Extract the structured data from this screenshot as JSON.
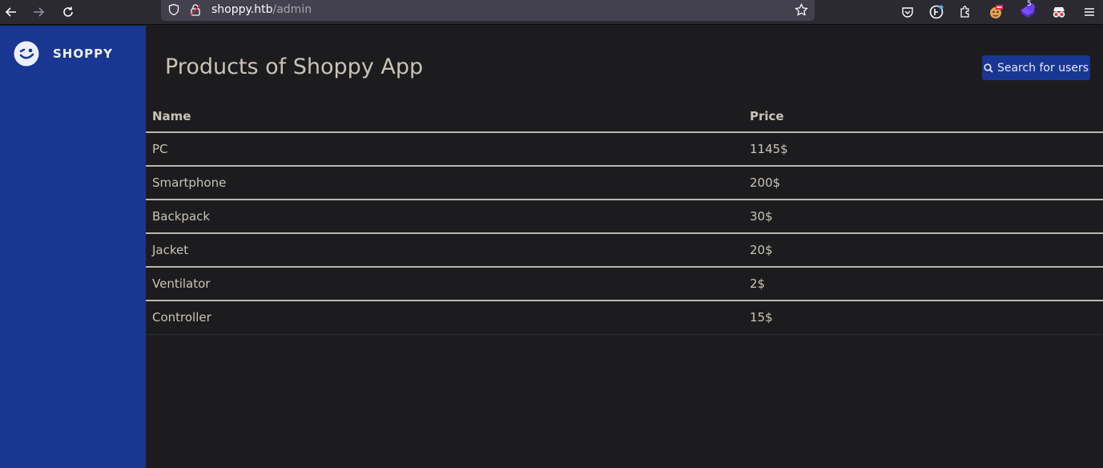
{
  "browser": {
    "url_host": "shoppy.htb",
    "url_path": "/admin",
    "extension_badge": "5"
  },
  "sidebar": {
    "brand_name": "SHOPPY"
  },
  "main": {
    "title": "Products of Shoppy App",
    "search_button_label": "Search for users",
    "table": {
      "columns": [
        "Name",
        "Price"
      ],
      "rows": [
        {
          "name": "PC",
          "price": "1145$"
        },
        {
          "name": "Smartphone",
          "price": "200$"
        },
        {
          "name": "Backpack",
          "price": "30$"
        },
        {
          "name": "Jacket",
          "price": "20$"
        },
        {
          "name": "Ventilator",
          "price": "2$"
        },
        {
          "name": "Controller",
          "price": "15$"
        }
      ]
    }
  },
  "colors": {
    "sidebar": "#1a3693",
    "background": "#1c1c1e",
    "text": "#c9c3b8"
  }
}
